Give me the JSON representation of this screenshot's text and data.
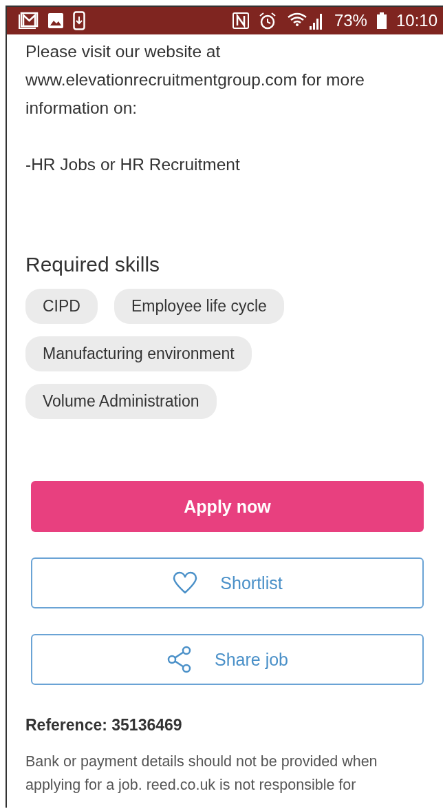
{
  "status_bar": {
    "battery": "73%",
    "time": "10:10"
  },
  "description": {
    "paragraphs": [
      "Please visit our website at www.elevationrecruitmentgroup.com for more information on:",
      "-HR Jobs or HR Recruitment"
    ]
  },
  "skills": {
    "heading": "Required skills",
    "items": [
      "CIPD",
      "Employee life cycle",
      "Manufacturing environment",
      "Volume Administration"
    ]
  },
  "actions": [
    {
      "kind": "apply",
      "label": "Apply now"
    },
    {
      "kind": "shortlist",
      "label": "Shortlist"
    },
    {
      "kind": "share",
      "label": "Share job"
    }
  ],
  "reference": "Reference: 35136469",
  "disclaimer": "Bank or payment details should not be provided when applying for a job. reed.co.uk is not responsible for"
}
